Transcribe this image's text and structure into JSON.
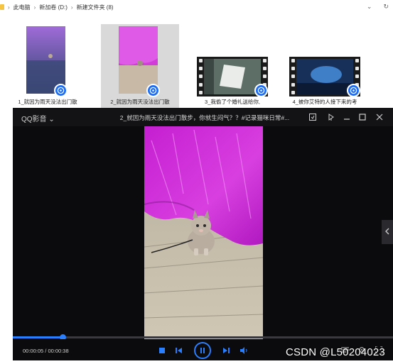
{
  "breadcrumb": {
    "items": [
      "此电脑",
      "新加卷 (D:)",
      "新建文件夹 (8)"
    ],
    "separator": "›"
  },
  "files": [
    {
      "label": "1_就因为雨天没法出门散",
      "type": "vertical",
      "selected": false
    },
    {
      "label": "2_就因为雨天没法出门散",
      "type": "vertical",
      "selected": true
    },
    {
      "label": "3_我偷了个婚礼送给你,",
      "type": "film",
      "selected": false
    },
    {
      "label": "4_被你艾特的人接下来的考",
      "type": "film",
      "selected": false
    }
  ],
  "player": {
    "brand": "QQ影音",
    "title": "2_就因为雨天没法出门散步，你就生闷气？？#记录猫咪日常#...",
    "time": "00:00:05 / 00:00:38",
    "progress_fraction": 0.13
  },
  "watermark": "CSDN @L50204023",
  "colors": {
    "accent": "#2a7fff",
    "player_bg": "#0b0b0d",
    "selected_bg": "#d9d9d9",
    "badge": "#1d6cf2"
  }
}
